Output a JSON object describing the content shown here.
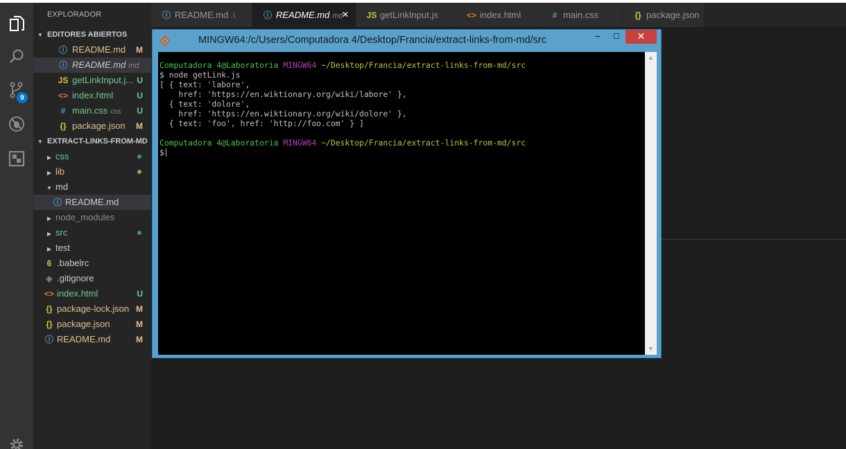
{
  "explorer_title": "EXPLORADOR",
  "open_editors": {
    "header": "EDITORES ABIERTOS",
    "items": [
      {
        "icon": "ⓘ",
        "label": "README.md",
        "hint": "",
        "status": "M",
        "color": "#e2c08d",
        "icon_color": "#519aba"
      },
      {
        "icon": "ⓘ",
        "label": "README.md",
        "hint": "md",
        "status": "",
        "color": "#cccccc",
        "icon_color": "#519aba"
      },
      {
        "icon": "JS",
        "label": "getLinkInput.j...",
        "hint": "",
        "status": "U",
        "color": "#73c991",
        "icon_color": "#cbcb41"
      },
      {
        "icon": "<>",
        "label": "index.html",
        "hint": "",
        "status": "U",
        "color": "#73c991",
        "icon_color": "#e37933"
      },
      {
        "icon": "#",
        "label": "main.css",
        "hint": "css",
        "status": "U",
        "color": "#73c991",
        "icon_color": "#519aba"
      },
      {
        "icon": "{}",
        "label": "package.json",
        "hint": "",
        "status": "M",
        "color": "#e2c08d",
        "icon_color": "#cbcb41"
      }
    ]
  },
  "project": {
    "header": "EXTRACT-LINKS-FROM-MD",
    "items": [
      {
        "label": "css",
        "kind": "folder",
        "expanded": false,
        "status": "dot",
        "color": "#73c991"
      },
      {
        "label": "lib",
        "kind": "folder",
        "expanded": false,
        "status": "dot-yellow",
        "color": "#e2c08d"
      },
      {
        "label": "md",
        "kind": "folder",
        "expanded": true,
        "status": "",
        "color": "#cccccc"
      },
      {
        "label": "README.md",
        "kind": "file",
        "icon": "ⓘ",
        "icon_color": "#519aba",
        "status": "",
        "color": "#cccccc"
      },
      {
        "label": "node_modules",
        "kind": "folder",
        "expanded": false,
        "status": "",
        "color": "#8c8c8c"
      },
      {
        "label": "src",
        "kind": "folder",
        "expanded": false,
        "status": "dot",
        "color": "#73c991"
      },
      {
        "label": "test",
        "kind": "folder",
        "expanded": false,
        "status": "",
        "color": "#cccccc"
      },
      {
        "label": ".babelrc",
        "kind": "file",
        "icon": "6",
        "icon_color": "#cbcb41",
        "status": "",
        "color": "#cccccc"
      },
      {
        "label": ".gitignore",
        "kind": "file",
        "icon": "◈",
        "icon_color": "#6d8086",
        "status": "",
        "color": "#cccccc"
      },
      {
        "label": "index.html",
        "kind": "file",
        "icon": "<>",
        "icon_color": "#e37933",
        "status": "U",
        "color": "#73c991"
      },
      {
        "label": "package-lock.json",
        "kind": "file",
        "icon": "{}",
        "icon_color": "#cbcb41",
        "status": "M",
        "color": "#e2c08d"
      },
      {
        "label": "package.json",
        "kind": "file",
        "icon": "{}",
        "icon_color": "#cbcb41",
        "status": "M",
        "color": "#e2c08d"
      },
      {
        "label": "README.md",
        "kind": "file",
        "icon": "ⓘ",
        "icon_color": "#519aba",
        "status": "M",
        "color": "#e2c08d"
      }
    ]
  },
  "source_control_badge": "9",
  "tabs": [
    {
      "icon": "ⓘ",
      "icon_color": "#519aba",
      "label": "README.md",
      "hint": ".\\",
      "active": false,
      "italic": false
    },
    {
      "icon": "ⓘ",
      "icon_color": "#519aba",
      "label": "README.md",
      "hint": "md",
      "active": true,
      "italic": true,
      "close": "✕"
    },
    {
      "icon": "JS",
      "icon_color": "#cbcb41",
      "label": "getLinkInput.js",
      "hint": "",
      "active": false,
      "italic": false
    },
    {
      "icon": "<>",
      "icon_color": "#e37933",
      "label": "index.html",
      "hint": "",
      "active": false,
      "italic": false
    },
    {
      "icon": "#",
      "icon_color": "#519aba",
      "label": "main.css",
      "hint": "",
      "active": false,
      "italic": false
    },
    {
      "icon": "{}",
      "icon_color": "#cbcb41",
      "label": "package.json",
      "hint": "",
      "active": false,
      "italic": false
    }
  ],
  "terminal": {
    "title": "MINGW64:/c/Users/Computadora 4/Desktop/Francia/extract-links-from-md/src",
    "minimize": "–",
    "maximize": "□",
    "close": "✕",
    "prompt_user": "Computadora 4@Laboratoria",
    "prompt_env": "MINGW64",
    "prompt_path": "~/Desktop/Francia/extract-links-from-md/src",
    "command": "$ node getLink.js",
    "output": [
      "[ { text: 'labore',",
      "    href: 'https://en.wiktionary.org/wiki/labore' },",
      "  { text: 'dolore',",
      "    href: 'https://en.wiktionary.org/wiki/dolore' },",
      "  { text: 'foo', href: 'http://foo.com' } ]"
    ],
    "prompt2_user": "Computadora 4@Laboratoria",
    "prompt2_env": "MINGW64",
    "prompt2_path": "~/Desktop/Francia/extract-links-from-md/src",
    "input_prompt": "$"
  }
}
